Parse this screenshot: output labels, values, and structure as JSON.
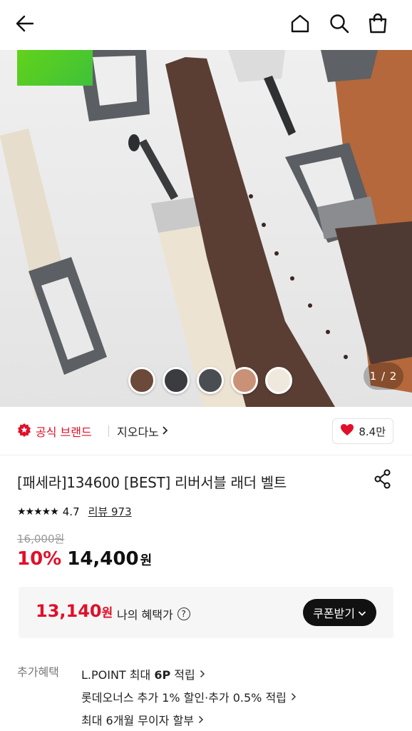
{
  "nav": {
    "back_icon": "arrow-left-icon",
    "home_icon": "home-icon",
    "search_icon": "search-icon",
    "cart_icon": "shopping-bag-icon"
  },
  "hero": {
    "page_indicator": "1 / 2",
    "color_swatches": [
      "#6b4a3a",
      "#3a3c3f",
      "#4a4d52",
      "#c99277",
      "#efe9dd"
    ]
  },
  "brand": {
    "official_label": "공식 브랜드",
    "brand_name": "지오다노",
    "like_count": "8.4만"
  },
  "product": {
    "title": "[패세라]134600 [BEST] 리버서블 래더 벨트",
    "rating": "4.7",
    "stars": "★★★★★",
    "review_label": "리뷰 973",
    "original_price": "16,000원",
    "discount": "10%",
    "sale_price": "14,400",
    "currency": "원"
  },
  "benefit": {
    "price": "13,140",
    "currency": "원",
    "label": "나의 혜택가",
    "coupon_button": "쿠폰받기"
  },
  "extra": {
    "label": "추가혜택",
    "items": [
      {
        "prefix": "L.POINT 최대 ",
        "bold": "6P",
        "suffix": " 적립"
      },
      {
        "prefix": "롯데오너스 추가 1% 할인·추가 0.5% 적립",
        "bold": "",
        "suffix": ""
      },
      {
        "prefix": "최대 6개월 무이자 할부",
        "bold": "",
        "suffix": ""
      }
    ]
  },
  "colors": {
    "accent_red": "#e0102a",
    "dark_button": "#111111"
  }
}
